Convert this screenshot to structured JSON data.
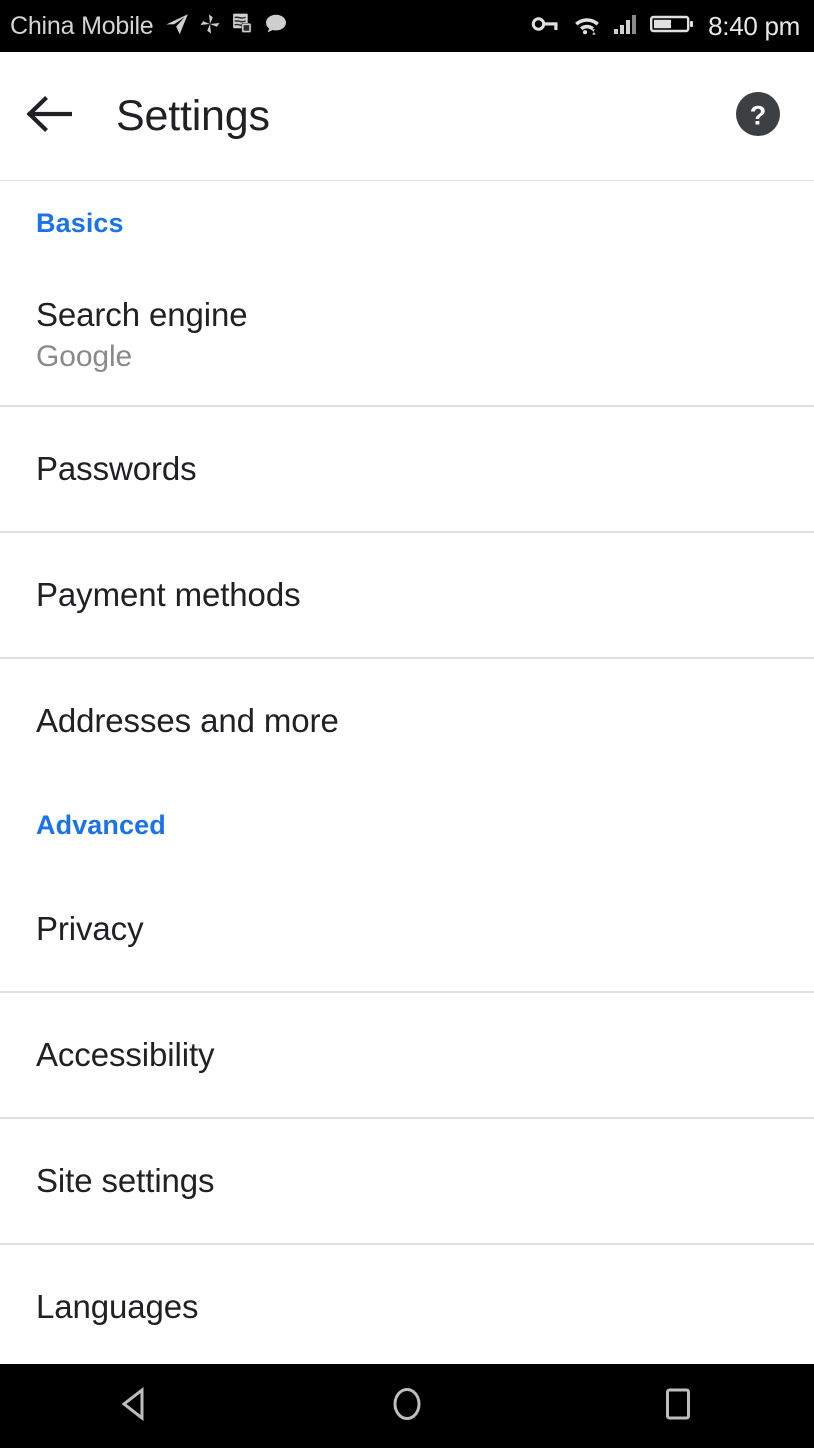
{
  "status_bar": {
    "carrier": "China Mobile",
    "time": "8:40 pm",
    "left_icons": [
      "telegram-plane-icon",
      "pinwheel-icon",
      "screenshot-document-icon",
      "chat-bubble-icon"
    ],
    "right_icons": [
      "vpn-key-icon",
      "wifi-icon",
      "cell-signal-icon",
      "battery-icon"
    ],
    "battery_level_percent": 52,
    "background_color": "#000000",
    "text_color": "#d4d4d4"
  },
  "app_bar": {
    "back_label": "Back",
    "title": "Settings",
    "help_label": "Help & feedback",
    "background_color": "#ffffff",
    "title_color": "#202124"
  },
  "accent_color": "#1a73e8",
  "sections": [
    {
      "header": "Basics",
      "items": [
        {
          "title": "Search engine",
          "subtitle": "Google"
        },
        {
          "title": "Passwords",
          "subtitle": ""
        },
        {
          "title": "Payment methods",
          "subtitle": ""
        },
        {
          "title": "Addresses and more",
          "subtitle": ""
        }
      ]
    },
    {
      "header": "Advanced",
      "items": [
        {
          "title": "Privacy",
          "subtitle": ""
        },
        {
          "title": "Accessibility",
          "subtitle": ""
        },
        {
          "title": "Site settings",
          "subtitle": ""
        },
        {
          "title": "Languages",
          "subtitle": ""
        }
      ]
    }
  ],
  "nav_bar": {
    "back": "back-triangle-icon",
    "home": "home-circle-icon",
    "recents": "recents-square-icon",
    "background_color": "#000000",
    "icon_color": "#bdbdbd"
  }
}
